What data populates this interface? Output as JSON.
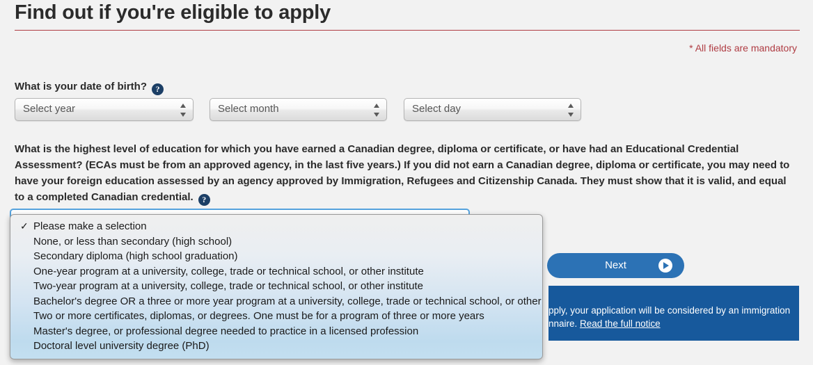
{
  "header": {
    "title": "Find out if you're eligible to apply",
    "mandatory_note": "* All fields are mandatory",
    "rule_color": "#af3c43",
    "note_color": "#af3c43"
  },
  "dob": {
    "question": "What is your date of birth?",
    "help_icon": "question-mark-icon",
    "help_glyph": "?",
    "selects": [
      {
        "name": "year",
        "value": "Select year"
      },
      {
        "name": "month",
        "value": "Select month"
      },
      {
        "name": "day",
        "value": "Select day"
      }
    ]
  },
  "education": {
    "question": "What is the highest level of education for which you have earned a Canadian degree, diploma or certificate, or have had an Educational Credential Assessment? (ECAs must be from an approved agency, in the last five years.) If you did not earn a Canadian degree, diploma or certificate, you may need to have your foreign education assessed by an agency approved by Immigration, Refugees and Citizenship Canada. They must show that it is valid, and equal to a completed Canadian credential.",
    "help_glyph": "?",
    "selected_value": "Please make a selection",
    "dropdown_open": true,
    "check_glyph": "✓",
    "options": [
      {
        "label": "Please make a selection",
        "selected": true
      },
      {
        "label": "None, or less than secondary (high school)",
        "selected": false
      },
      {
        "label": "Secondary diploma (high school graduation)",
        "selected": false
      },
      {
        "label": "One-year program at a university, college, trade or technical school, or other institute",
        "selected": false
      },
      {
        "label": "Two-year program at a university, college, trade or technical school, or other institute",
        "selected": false
      },
      {
        "label": "Bachelor's degree OR a three or more year program at a university, college, trade or technical school, or other institute",
        "selected": false
      },
      {
        "label": "Two or more certificates, diplomas, or degrees. One must be for a program of three or more years",
        "selected": false
      },
      {
        "label": "Master's degree, or professional degree needed to practice in a licensed profession",
        "selected": false
      },
      {
        "label": "Doctoral level university degree (PhD)",
        "selected": false
      }
    ]
  },
  "next_button": {
    "label": "Next",
    "icon": "play-circle-icon",
    "color": "#2c72b5"
  },
  "notice": {
    "text_visible": "pply, your application will be considered by an immigration",
    "text_visible_line2": "nnaire. ",
    "link_label": "Read the full notice",
    "background": "#17599c"
  }
}
